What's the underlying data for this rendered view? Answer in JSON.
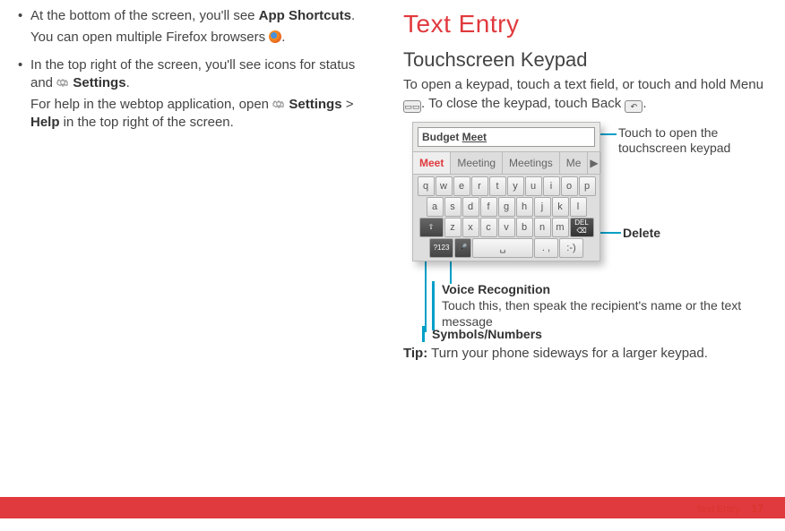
{
  "left": {
    "b1_a": "At the bottom of the screen, you'll see ",
    "b1_strong": "App Shortcuts",
    "b1_tail": ".",
    "b1_sub": "You can open multiple Firefox browsers ",
    "b1_sub_tail": ".",
    "b2_a": "In the top right of the screen, you'll see icons for status and ",
    "b2_strong": "Settings",
    "b2_tail": ".",
    "b2_sub_a": "For help in the webtop application, open ",
    "b2_sub_strong1": "Settings",
    "b2_sub_mid": " > ",
    "b2_sub_strong2": "Help",
    "b2_sub_b": " in the top right of the screen."
  },
  "right": {
    "h1": "Text Entry",
    "h2": "Touchscreen Keypad",
    "intro_a": "To open a keypad, touch a text field, or touch and hold Menu ",
    "intro_b": ". To close the keypad, touch Back ",
    "intro_c": ".",
    "tip_label": "Tip:",
    "tip_body": " Turn your phone sideways for a larger keypad."
  },
  "keypad": {
    "input_word1": "Budget",
    "input_word2": "Meet",
    "suggestions": [
      "Meet",
      "Meeting",
      "Meetings",
      "Me"
    ],
    "row1": [
      "q",
      "w",
      "e",
      "r",
      "t",
      "y",
      "u",
      "i",
      "o",
      "p"
    ],
    "row2": [
      "a",
      "s",
      "d",
      "f",
      "g",
      "h",
      "j",
      "k",
      "l"
    ],
    "row3": [
      "z",
      "x",
      "c",
      "v",
      "b",
      "n",
      "m"
    ],
    "shift": "⇧",
    "del_top": "DEL",
    "del_icon": "⌫",
    "sym": "?123",
    "mic": "🎤",
    "space": "␣",
    "punct": ". ,",
    "smiley": ":-)"
  },
  "callouts": {
    "open": "Touch to open the touchscreen keypad",
    "delete": "Delete",
    "voice_title": "Voice Recognition",
    "voice_body": "Touch this, then speak the recipient's name or the text message",
    "symnum": "Symbols/Numbers"
  },
  "footer": {
    "section": "Text Entry",
    "page": "17"
  }
}
